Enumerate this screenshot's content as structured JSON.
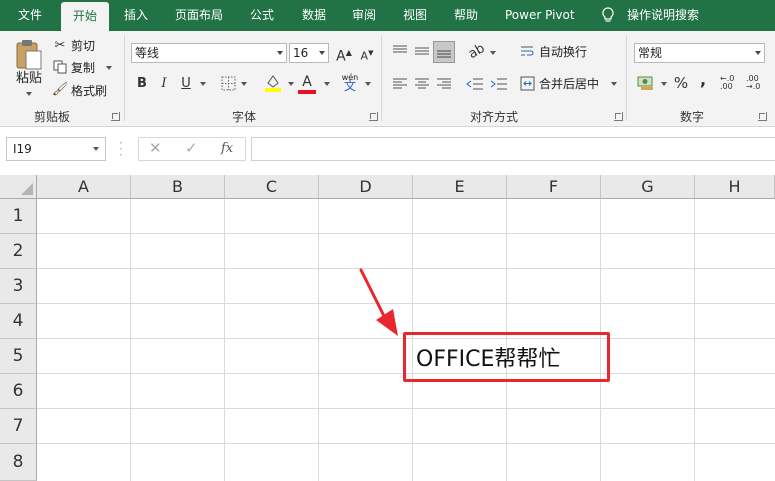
{
  "ribbon_tabs": [
    "文件",
    "开始",
    "插入",
    "页面布局",
    "公式",
    "数据",
    "审阅",
    "视图",
    "帮助",
    "Power Pivot"
  ],
  "tell_me": "操作说明搜索",
  "clipboard": {
    "paste": "粘贴",
    "cut": "剪切",
    "copy": "复制",
    "format_painter": "格式刷",
    "label": "剪贴板"
  },
  "font": {
    "name": "等线",
    "size": "16",
    "bold": "B",
    "italic": "I",
    "underline": "U",
    "grow": "A",
    "shrink": "A",
    "font_color_glyph": "A",
    "phonetic": "wén",
    "phonetic_char": "文",
    "label": "字体"
  },
  "alignment": {
    "wrap_text": "自动换行",
    "merge_center": "合并后居中",
    "label": "对齐方式"
  },
  "number": {
    "format": "常规",
    "percent": "%",
    "comma": ",",
    "inc_decimal": "←.0\n.00",
    "label": "数字"
  },
  "formula_bar": {
    "name_box": "I19",
    "fx": "fx",
    "formula": ""
  },
  "columns": [
    "A",
    "B",
    "C",
    "D",
    "E",
    "F",
    "G",
    "H"
  ],
  "rows": [
    "1",
    "2",
    "3",
    "4",
    "5",
    "6",
    "7",
    "8"
  ],
  "cell_text": "OFFICE帮帮忙",
  "colors": {
    "ribbon_green": "#217346",
    "annotation_red": "#e8272e"
  }
}
